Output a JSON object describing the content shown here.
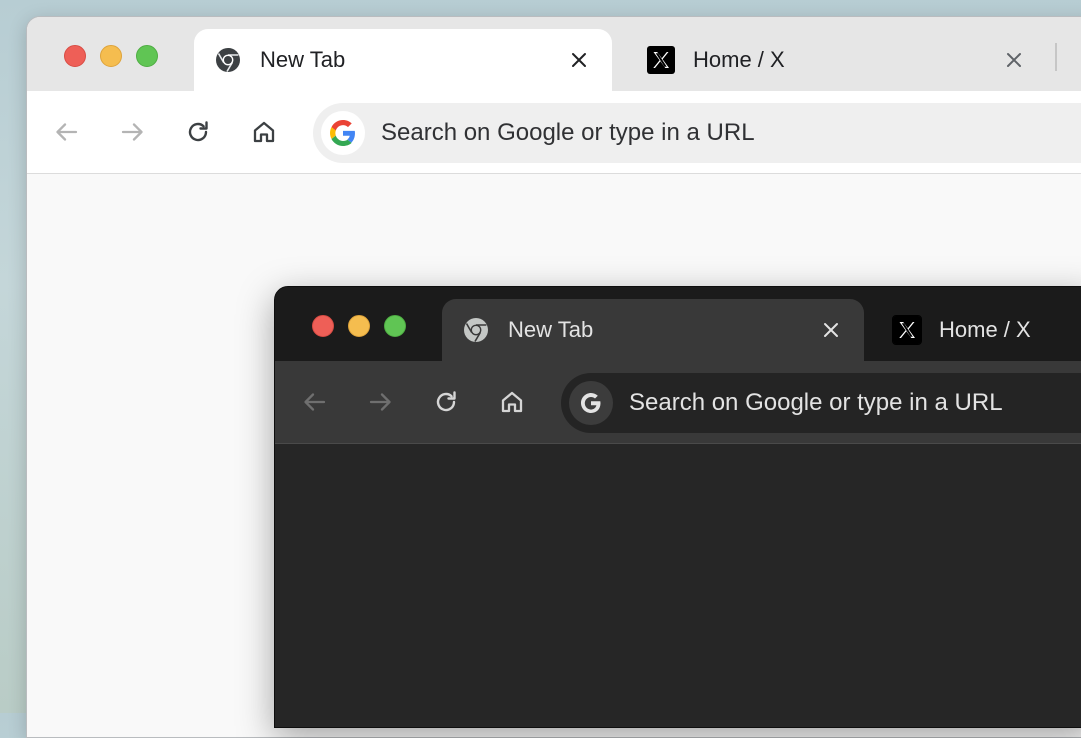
{
  "windows": [
    {
      "theme": "light",
      "tabs": [
        {
          "title": "New Tab",
          "icon": "chrome-icon",
          "active": true
        },
        {
          "title": "Home / X",
          "icon": "x-logo-icon",
          "active": false
        }
      ],
      "omnibox": {
        "placeholder": "Search on Google or type in a URL",
        "icon": "google-g-icon"
      },
      "toolbar": [
        "back-arrow-icon",
        "forward-arrow-icon",
        "reload-icon",
        "home-icon"
      ]
    },
    {
      "theme": "dark",
      "tabs": [
        {
          "title": "New Tab",
          "icon": "chrome-icon",
          "active": true
        },
        {
          "title": "Home / X",
          "icon": "x-logo-icon",
          "active": false
        }
      ],
      "omnibox": {
        "placeholder": "Search on Google or type in a URL",
        "icon": "google-g-icon"
      },
      "toolbar": [
        "back-arrow-icon",
        "forward-arrow-icon",
        "reload-icon",
        "home-icon"
      ]
    }
  ],
  "colors": {
    "traffic_red": "#ee5f57",
    "traffic_yellow": "#f5bd4f",
    "traffic_green": "#60c554",
    "light_tabstrip": "#e6e6e6",
    "dark_tabstrip": "#1b1b1b",
    "dark_toolbar": "#393939"
  }
}
